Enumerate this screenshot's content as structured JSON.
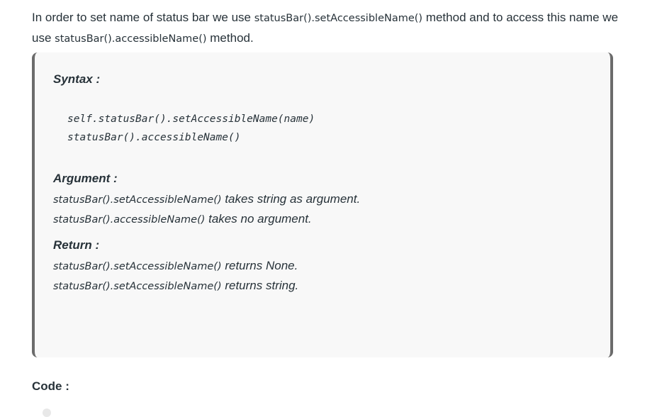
{
  "intro": {
    "part1": "In order to set name of status bar we use ",
    "code1": "statusBar().setAccessibleName()",
    "part2": " method and to access this name we use ",
    "code2": "statusBar().accessibleName()",
    "part3": " method."
  },
  "syntax": {
    "label": "Syntax :",
    "lines": [
      "self.statusBar().setAccessibleName(name)",
      "statusBar().accessibleName()"
    ]
  },
  "argument": {
    "label": "Argument :",
    "lines": [
      {
        "fn": "statusBar().setAccessibleName()",
        "text": " takes string as argument."
      },
      {
        "fn": "statusBar().accessibleName()",
        "text": " takes no argument."
      }
    ]
  },
  "return": {
    "label": "Return :",
    "lines": [
      {
        "fn": "statusBar().setAccessibleName()",
        "text": " returns None."
      },
      {
        "fn": "statusBar().setAccessibleName()",
        "text": " returns string."
      }
    ]
  },
  "code_heading": "Code :"
}
